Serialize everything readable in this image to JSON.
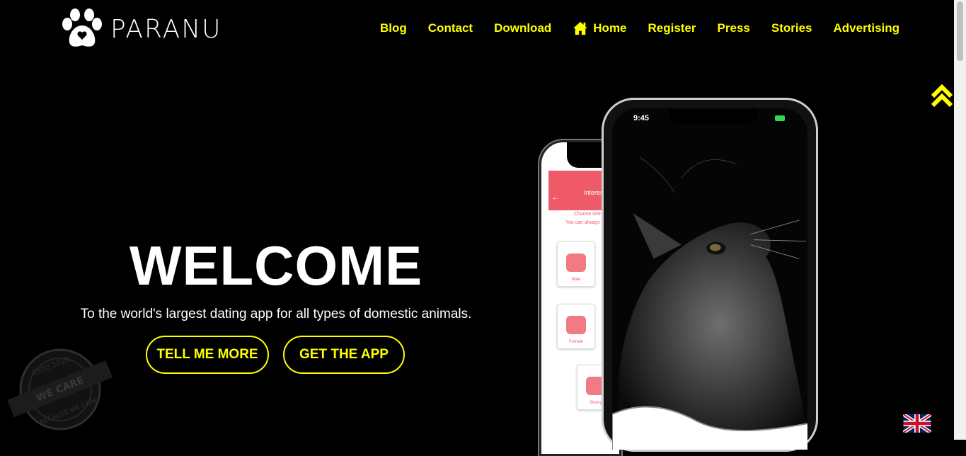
{
  "brand": {
    "name": "PARANU"
  },
  "nav": {
    "items": [
      {
        "label": "Blog"
      },
      {
        "label": "Contact"
      },
      {
        "label": "Download"
      },
      {
        "label": "Home",
        "icon": "home-icon"
      },
      {
        "label": "Register"
      },
      {
        "label": "Press"
      },
      {
        "label": "Stories"
      },
      {
        "label": "Advertising"
      }
    ]
  },
  "hero": {
    "title": "WELCOME",
    "subtitle": "To the world's largest dating app for all types of domestic animals.",
    "primary_button": "TELL ME MORE",
    "secondary_button": "GET THE APP"
  },
  "stamp": {
    "text": "ESTD 2019 · WE CARE · BECAUSE WE CARE"
  },
  "phone": {
    "time": "9:45",
    "back_screen": {
      "header": "Interes",
      "line1": "Choose one or",
      "line2": "You can always ch",
      "cards": [
        "Male",
        "Female",
        "Strong"
      ]
    }
  },
  "colors": {
    "accent": "#ffff00",
    "background": "#000000",
    "app_red": "#ee5a67"
  },
  "language": {
    "current": "English",
    "icon": "uk-flag-icon"
  }
}
